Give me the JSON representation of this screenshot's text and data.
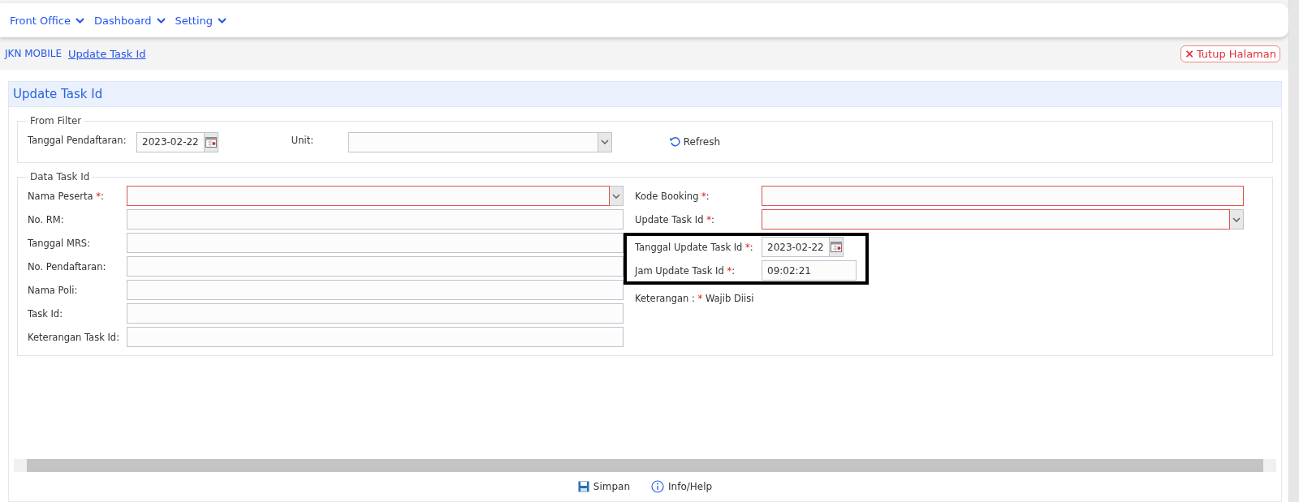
{
  "menu": [
    {
      "label": "Front Office"
    },
    {
      "label": "Dashboard"
    },
    {
      "label": "Setting"
    }
  ],
  "breadcrumb": {
    "items": [
      {
        "label": "JKN MOBILE",
        "current": false
      },
      {
        "label": "Update Task Id",
        "current": true
      }
    ]
  },
  "close_button": {
    "label": "Tutup Halaman",
    "icon": "×"
  },
  "panel": {
    "title": "Update Task Id",
    "filter": {
      "legend": "From Filter",
      "date_label": "Tanggal Pendaftaran:",
      "date_value": "2023-02-22",
      "unit_label": "Unit:",
      "refresh_label": "Refresh"
    },
    "data": {
      "legend": "Data Task Id",
      "left_fields": [
        {
          "kind": "select",
          "label": "Nama Peserta ",
          "mark": "*",
          "after": ":",
          "invalid": true
        },
        {
          "kind": "text",
          "label": "No. RM:",
          "invalid": false
        },
        {
          "kind": "text",
          "label": "Tanggal MRS:",
          "invalid": false
        },
        {
          "kind": "text",
          "label": "No. Pendaftaran:",
          "invalid": false
        },
        {
          "kind": "text",
          "label": "Nama Poli:",
          "invalid": false
        },
        {
          "kind": "text",
          "label": "Task Id:",
          "invalid": false
        },
        {
          "kind": "text",
          "label": "Keterangan Task Id:",
          "invalid": false
        }
      ],
      "right_fields": [
        {
          "kind": "text",
          "label": "Kode Booking ",
          "mark": "*",
          "after": ":",
          "invalid": true
        },
        {
          "kind": "select",
          "label": "Update Task Id ",
          "mark": "*",
          "after": ":",
          "invalid": true
        }
      ],
      "highlighted_fields": [
        {
          "kind": "date",
          "label": "Tanggal Update Task Id ",
          "mark": "*",
          "after": ":",
          "value": "2023-02-22",
          "invalid": false
        },
        {
          "kind": "text",
          "label": "Jam Update Task Id ",
          "mark": "*",
          "after": ":",
          "value": "09:02:21",
          "invalid": false
        }
      ],
      "note": {
        "label": "Keterangan : ",
        "mark": "*",
        "after": " Wajib Diisi"
      }
    }
  },
  "footer_buttons": [
    {
      "kind": "save",
      "label": "Simpan"
    },
    {
      "kind": "info",
      "label": "Info/Help"
    }
  ]
}
